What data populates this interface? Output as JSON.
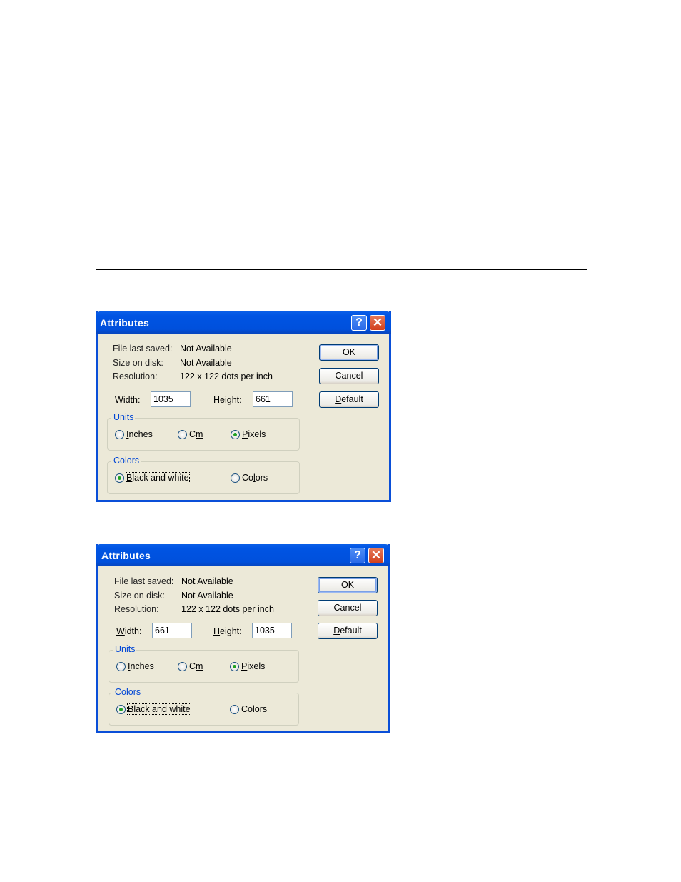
{
  "table": {
    "rows": [
      [
        "",
        ""
      ],
      [
        "",
        ""
      ]
    ]
  },
  "dialogs": [
    {
      "title": "Attributes",
      "help_icon": "question-mark",
      "close_icon": "x",
      "info": [
        {
          "label": "File last saved:",
          "value": "Not Available"
        },
        {
          "label": "Size on disk:",
          "value": "Not Available"
        },
        {
          "label": "Resolution:",
          "value": "122 x 122 dots per inch"
        }
      ],
      "width_label": "Width:",
      "width_value": "1035",
      "height_label": "Height:",
      "height_value": "661",
      "buttons": {
        "ok": "OK",
        "cancel": "Cancel",
        "default": "Default"
      },
      "units": {
        "label": "Units",
        "options": [
          "Inches",
          "Cm",
          "Pixels"
        ],
        "selected": "Pixels"
      },
      "colors": {
        "label": "Colors",
        "options": [
          "Black and white",
          "Colors"
        ],
        "selected": "Black and white"
      }
    },
    {
      "title": "Attributes",
      "help_icon": "question-mark",
      "close_icon": "x",
      "info": [
        {
          "label": "File last saved:",
          "value": "Not Available"
        },
        {
          "label": "Size on disk:",
          "value": "Not Available"
        },
        {
          "label": "Resolution:",
          "value": "122 x 122 dots per inch"
        }
      ],
      "width_label": "Width:",
      "width_value": "661",
      "height_label": "Height:",
      "height_value": "1035",
      "buttons": {
        "ok": "OK",
        "cancel": "Cancel",
        "default": "Default"
      },
      "units": {
        "label": "Units",
        "options": [
          "Inches",
          "Cm",
          "Pixels"
        ],
        "selected": "Pixels"
      },
      "colors": {
        "label": "Colors",
        "options": [
          "Black and white",
          "Colors"
        ],
        "selected": "Black and white"
      }
    }
  ],
  "colors": {
    "titlebar": "#0054e3",
    "dialog_bg": "#ece9d8",
    "group_label": "#0046d5",
    "close": "#d2401c"
  }
}
